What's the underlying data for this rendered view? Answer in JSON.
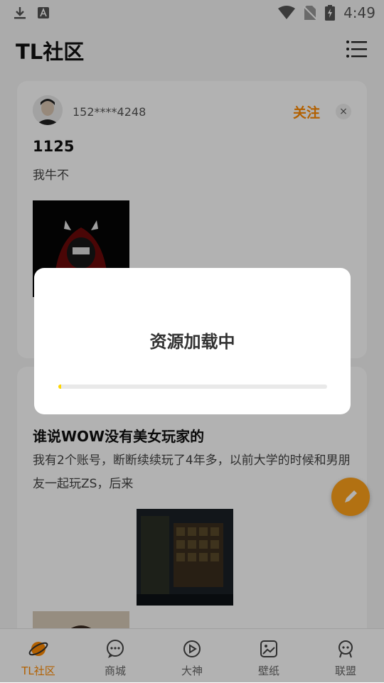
{
  "status_bar": {
    "time": "4:49"
  },
  "header": {
    "title": "TL社区"
  },
  "posts": [
    {
      "username": "152****4248",
      "follow_label": "关注",
      "close_label": "×",
      "title": "1125",
      "body": "我牛不"
    },
    {
      "title": "谁说WOW没有美女玩家的",
      "body": "我有2个账号，断断续续玩了4年多，以前大学的时候和男朋友一起玩ZS，后来"
    }
  ],
  "tabs": [
    {
      "label": "TL社区",
      "icon": "planet-icon",
      "active": true
    },
    {
      "label": "商城",
      "icon": "chat-bubble-icon",
      "active": false
    },
    {
      "label": "大神",
      "icon": "play-icon",
      "active": false
    },
    {
      "label": "壁纸",
      "icon": "image-icon",
      "active": false
    },
    {
      "label": "联盟",
      "icon": "alliance-icon",
      "active": false
    }
  ],
  "loading_dialog": {
    "title": "资源加载中",
    "progress": 0.01
  },
  "colors": {
    "accent": "#ff8a00",
    "progress": "#ffd600",
    "fab": "#ffa31a"
  }
}
